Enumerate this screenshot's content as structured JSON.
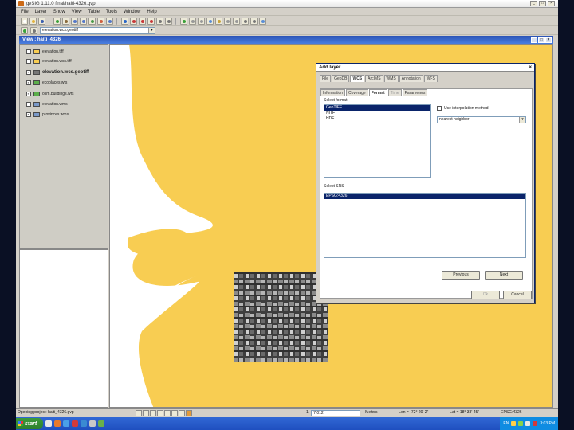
{
  "window": {
    "title": "gvSIG 1.11.0 final/haiti-4326.gvp",
    "controls": [
      "_",
      "□",
      "×"
    ]
  },
  "menubar": [
    "File",
    "Layer",
    "Show",
    "View",
    "Table",
    "Tools",
    "Window",
    "Help"
  ],
  "layer_select": {
    "value": "elevation.wcs.geotiff"
  },
  "view": {
    "title": "View : haiti_4326",
    "controls": [
      "_",
      "□",
      "×"
    ]
  },
  "toc": {
    "layers": [
      {
        "name": "elevation.tiff",
        "checked": false,
        "active": false
      },
      {
        "name": "elevation.wcs.tiff",
        "checked": false,
        "active": false
      },
      {
        "name": "elevation.wcs.geotiff",
        "checked": true,
        "active": true
      },
      {
        "name": "ecoplaces.wfs",
        "checked": true,
        "active": false
      },
      {
        "name": "osm.buildings.wfs",
        "checked": true,
        "active": false
      },
      {
        "name": "elevation.wms",
        "checked": false,
        "active": false
      },
      {
        "name": "provinces.wms",
        "checked": true,
        "active": false
      }
    ]
  },
  "colors": {
    "map_land": "#f8cd52",
    "map_water": "#ffffff",
    "dialog_selection": "#0a246a",
    "title_bar": "#2c54b6",
    "taskbar": "#3168d5"
  },
  "dialog": {
    "title": "Add layer...",
    "close": "×",
    "main_tabs": [
      {
        "label": "File",
        "state": "normal"
      },
      {
        "label": "GeoDB",
        "state": "normal"
      },
      {
        "label": "WCS",
        "state": "active"
      },
      {
        "label": "ArcIMS",
        "state": "normal"
      },
      {
        "label": "WMS",
        "state": "normal"
      },
      {
        "label": "Annotation",
        "state": "normal"
      },
      {
        "label": "WFS",
        "state": "normal"
      }
    ],
    "sub_tabs": [
      {
        "label": "Information",
        "state": "normal"
      },
      {
        "label": "Coverage",
        "state": "normal"
      },
      {
        "label": "Format",
        "state": "active"
      },
      {
        "label": "Time",
        "state": "disabled"
      },
      {
        "label": "Parameters",
        "state": "normal"
      }
    ],
    "format_group_label": "Select format",
    "formats": [
      {
        "label": "GeoTIFF",
        "selected": true
      },
      {
        "label": "NITF",
        "selected": false
      },
      {
        "label": "HDF",
        "selected": false
      }
    ],
    "interpolation_label": "Use interpolation method",
    "interpolation_value": "nearest neighbor",
    "srs_group_label": "Select SRS",
    "srs": [
      {
        "label": "EPSG:4326",
        "selected": true
      }
    ],
    "previous_label": "Previous",
    "next_label": "Next",
    "ok_label": "Ok",
    "cancel_label": "Cancel"
  },
  "statusbar": {
    "message": "Opening project: haiti_4326.gvp",
    "scale_prefix": "1:",
    "scale_value": "7,012",
    "units": "Meters",
    "lon": "Lon = -72° 20' 2\"",
    "lat": "Lat = 18° 33' 45\"",
    "crs": "EPSG:4326"
  },
  "taskbar": {
    "start_label": "start",
    "language": "EN",
    "clock": "3:03 PM"
  }
}
